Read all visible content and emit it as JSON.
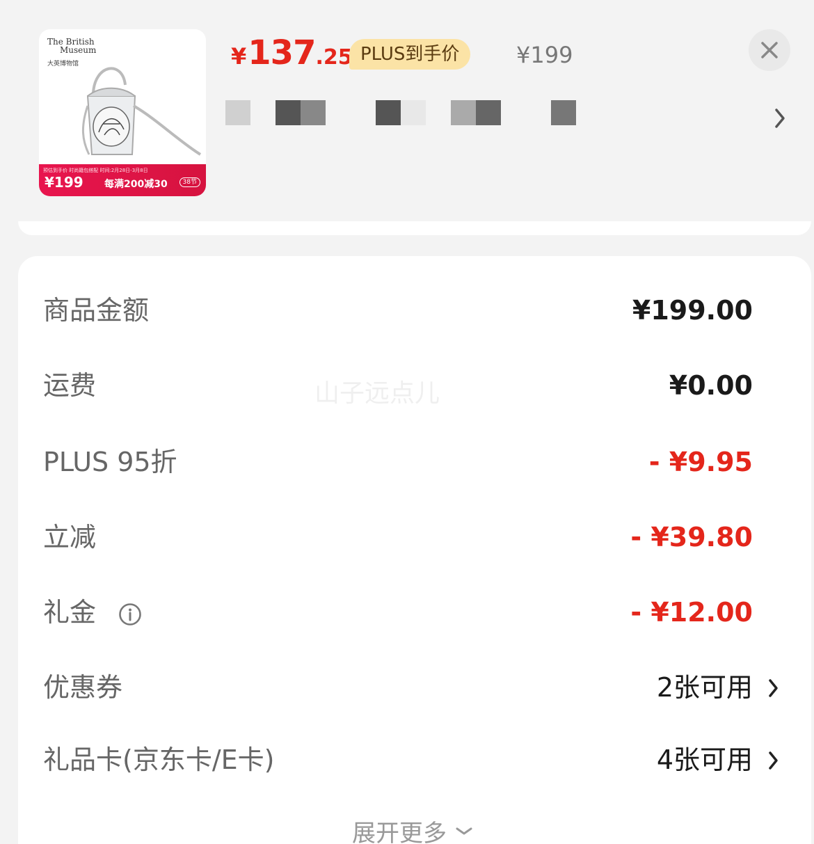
{
  "product": {
    "thumb_logo_line1": "The British",
    "thumb_logo_line2": "Museum",
    "thumb_logo_cn": "大英博物馆",
    "thumb_banner_top": "预估到手价   时尚籍包搭配   时间:2月28日-3月8日",
    "thumb_banner_price": "¥199",
    "thumb_banner_promo": "每满200减30",
    "thumb_banner_tag": "38节",
    "price_symbol": "¥",
    "price_integer": "137",
    "price_decimal": ".25",
    "plus_badge": "PLUS到手价",
    "original_price": "¥199"
  },
  "summary": {
    "rows": [
      {
        "label": "商品金额",
        "value": "¥199.00"
      },
      {
        "label": "运费",
        "value": "¥0.00"
      },
      {
        "label": "PLUS 95折",
        "value": "- ¥9.95"
      },
      {
        "label": "立减",
        "value": "- ¥39.80"
      },
      {
        "label": "礼金",
        "value": "- ¥12.00"
      },
      {
        "label": "优惠券",
        "value": "2张可用"
      },
      {
        "label": "礼品卡(京东卡/E卡)",
        "value": "4张可用"
      }
    ],
    "expand_more": "展开更多"
  },
  "watermark": "山子远点儿",
  "colors": {
    "accent_red": "#e4261b",
    "plus_badge_bg": "#fbe3a6",
    "page_bg": "#f3f3f3"
  },
  "icons": {
    "close": "close-icon",
    "chevron": "chevron-right-icon",
    "info": "info-icon",
    "expand": "chevron-down-icon"
  }
}
